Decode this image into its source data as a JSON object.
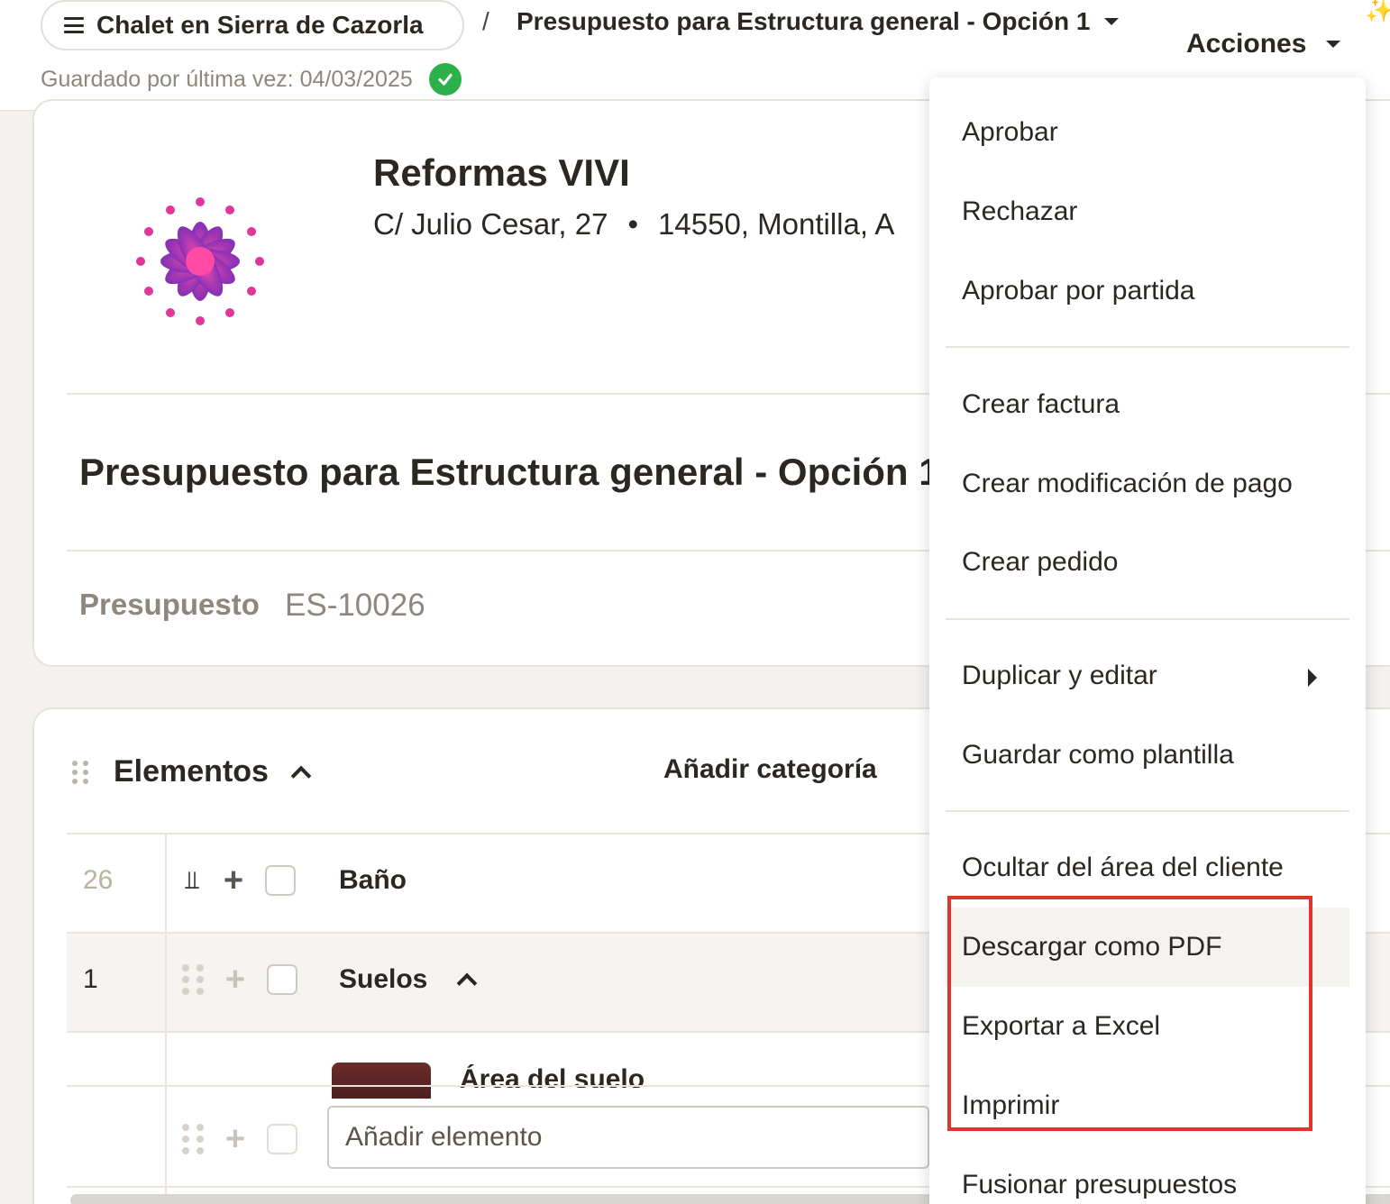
{
  "header": {
    "project_name": "Chalet en Sierra de Cazorla",
    "breadcrumb_separator": "/",
    "document_title": "Presupuesto para Estructura general - Opción 1",
    "saved_text": "Guardado por última vez: 04/03/2025",
    "actions_label": "Acciones",
    "sparkle": "✨"
  },
  "company": {
    "name": "Reformas VIVI",
    "street": "C/ Julio Cesar, 27",
    "bullet": "•",
    "city": "14550, Montilla, A"
  },
  "document": {
    "title": "Presupuesto para Estructura general - Opción 1",
    "type_label": "Presupuesto",
    "number": "ES-10026"
  },
  "elements": {
    "title": "Elementos",
    "add_category": "Añadir categoría",
    "rows": [
      {
        "num": "26",
        "label": "Baño"
      },
      {
        "num": "1",
        "label": "Suelos"
      }
    ],
    "item_label": "Área del suelo",
    "add_item_placeholder": "Añadir elemento"
  },
  "menu": {
    "items": [
      "Aprobar",
      "Rechazar",
      "Aprobar por partida",
      "Crear factura",
      "Crear modificación de pago",
      "Crear pedido",
      "Duplicar y editar",
      "Guardar como plantilla",
      "Ocultar del área del cliente",
      "Descargar como PDF",
      "Exportar a Excel",
      "Imprimir",
      "Fusionar presupuestos"
    ]
  },
  "colors": {
    "accent_success": "#2cb14a",
    "highlight": "#e0352b",
    "logo_pink": "#ff3fa0",
    "logo_purple": "#7a1fb0"
  }
}
